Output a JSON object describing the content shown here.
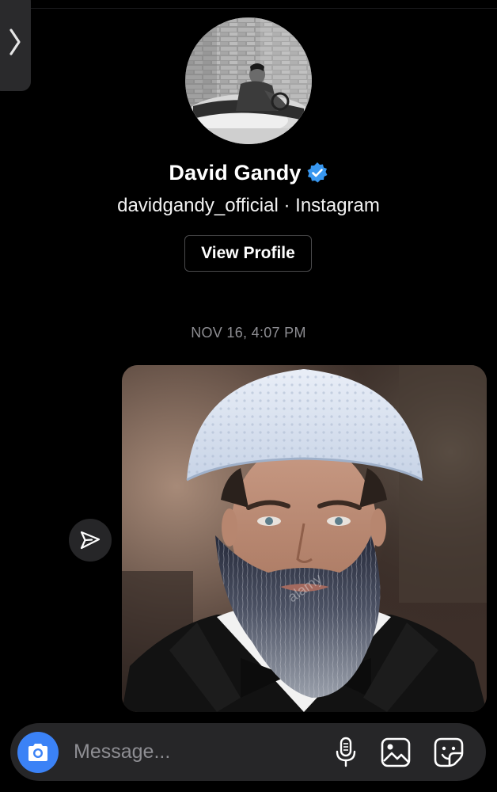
{
  "profile": {
    "name": "David Gandy",
    "username": "davidgandy_official",
    "separator": " · ",
    "platform": "Instagram",
    "verified": true,
    "view_profile_label": "View Profile"
  },
  "conversation": {
    "timestamp": "NOV 16, 4:07 PM",
    "messages": [
      {
        "type": "photo",
        "description_icon": "photo-message",
        "watermark": "alamy"
      }
    ]
  },
  "composer": {
    "placeholder": "Message..."
  },
  "icons": {
    "back": "chevron-right-icon",
    "verified": "verified-badge-icon",
    "share": "paper-plane-icon",
    "camera": "camera-icon",
    "mic": "microphone-icon",
    "gallery": "gallery-icon",
    "sticker": "sticker-icon"
  },
  "colors": {
    "background": "#000000",
    "accent": "#3b82f6",
    "verified_badge": "#3897f0",
    "secondary_text": "#8e8e93",
    "composer_bg": "#262628"
  }
}
